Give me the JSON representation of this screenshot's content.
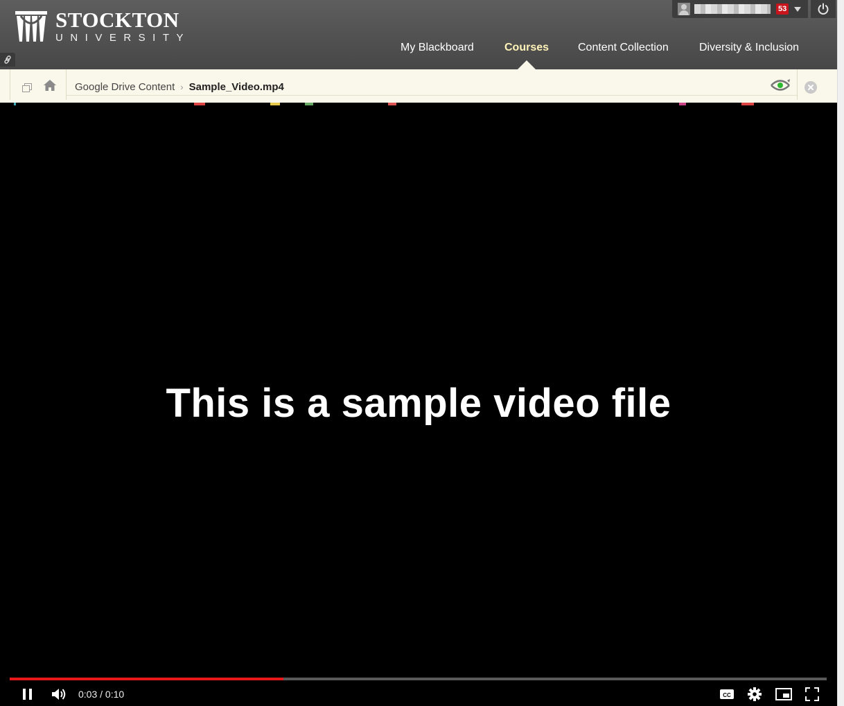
{
  "header": {
    "logo_name": "STOCKTON",
    "logo_sub": "UNIVERSITY",
    "notification_count": "53",
    "nav": [
      {
        "label": "My Blackboard",
        "active": false
      },
      {
        "label": "Courses",
        "active": true
      },
      {
        "label": "Content Collection",
        "active": false
      },
      {
        "label": "Diversity & Inclusion",
        "active": false
      }
    ]
  },
  "breadcrumb": {
    "parent": "Google Drive Content",
    "current": "Sample_Video.mp4"
  },
  "video": {
    "caption": "This is a sample video file",
    "time": "0:03 / 0:10",
    "progress_fraction": 0.335,
    "progress_color": "#e81818"
  },
  "icons": {
    "logo": "stockton-logo-icon",
    "user": "user-avatar-icon",
    "power": "power-icon",
    "link": "link-icon",
    "window": "new-window-icon",
    "home": "home-icon",
    "preview": "eye-toggle-icon",
    "close": "close-icon",
    "pause": "pause-icon",
    "volume": "volume-icon",
    "captions": "cc-icon",
    "settings": "settings-gear-icon",
    "miniplayer": "miniplayer-icon",
    "fullscreen": "fullscreen-icon"
  }
}
